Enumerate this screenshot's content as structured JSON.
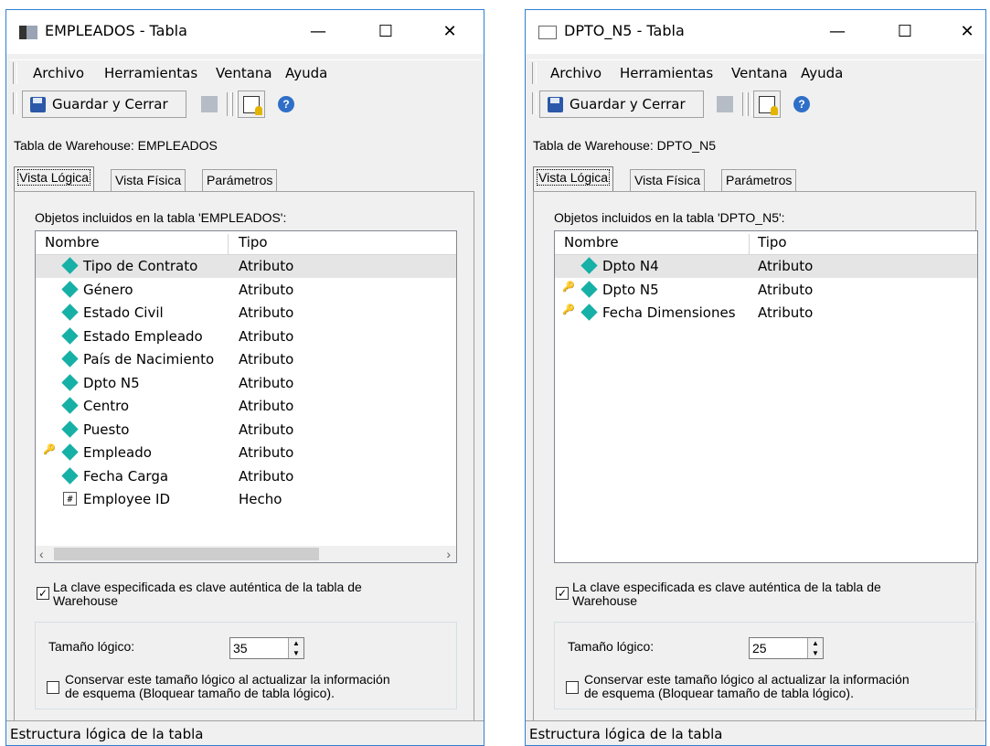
{
  "windows": [
    {
      "title": "EMPLEADOS - Tabla",
      "menu": [
        "Archivo",
        "Herramientas",
        "Ventana",
        "Ayuda"
      ],
      "toolbar": {
        "save_label": "Guardar y Cerrar"
      },
      "warehouse_label": "Tabla de Warehouse: EMPLEADOS",
      "tabs": [
        "Vista Lógica",
        "Vista Física",
        "Parámetros"
      ],
      "objects_label": "Objetos incluidos en la tabla 'EMPLEADOS':",
      "columns": [
        "Nombre",
        "Tipo"
      ],
      "rows": [
        {
          "name": "Tipo de Contrato",
          "type": "Atributo",
          "icon": "attribute-icon",
          "key": false
        },
        {
          "name": "Género",
          "type": "Atributo",
          "icon": "attribute-icon",
          "key": false
        },
        {
          "name": "Estado Civil",
          "type": "Atributo",
          "icon": "attribute-icon",
          "key": false
        },
        {
          "name": "Estado Empleado",
          "type": "Atributo",
          "icon": "attribute-icon",
          "key": false
        },
        {
          "name": "País de Nacimiento",
          "type": "Atributo",
          "icon": "attribute-icon",
          "key": false
        },
        {
          "name": "Dpto N5",
          "type": "Atributo",
          "icon": "attribute-icon",
          "key": false
        },
        {
          "name": "Centro",
          "type": "Atributo",
          "icon": "attribute-icon",
          "key": false
        },
        {
          "name": "Puesto",
          "type": "Atributo",
          "icon": "attribute-icon",
          "key": false
        },
        {
          "name": "Empleado",
          "type": "Atributo",
          "icon": "attribute-icon",
          "key": true
        },
        {
          "name": "Fecha Carga",
          "type": "Atributo",
          "icon": "attribute-icon",
          "key": false
        },
        {
          "name": "Employee ID",
          "type": "Hecho",
          "icon": "fact-icon",
          "key": false
        }
      ],
      "key_checkbox": {
        "label1": "La clave especificada es clave auténtica de la tabla de",
        "label2": "Warehouse",
        "checked": true
      },
      "logical_size_label": "Tamaño lógico:",
      "logical_size_value": "35",
      "preserve_checkbox": {
        "label1": "Conservar este tamaño lógico al actualizar la información",
        "label2": "de esquema (Bloquear tamaño de tabla lógico).",
        "checked": false
      },
      "status": "Estructura lógica de la tabla"
    },
    {
      "title": "DPTO_N5 - Tabla",
      "menu": [
        "Archivo",
        "Herramientas",
        "Ventana",
        "Ayuda"
      ],
      "toolbar": {
        "save_label": "Guardar y Cerrar"
      },
      "warehouse_label": "Tabla de Warehouse: DPTO_N5",
      "tabs": [
        "Vista Lógica",
        "Vista Física",
        "Parámetros"
      ],
      "objects_label": "Objetos incluidos en la tabla 'DPTO_N5':",
      "columns": [
        "Nombre",
        "Tipo"
      ],
      "rows": [
        {
          "name": "Dpto N4",
          "type": "Atributo",
          "icon": "attribute-icon",
          "key": false
        },
        {
          "name": "Dpto N5",
          "type": "Atributo",
          "icon": "attribute-icon",
          "key": true
        },
        {
          "name": "Fecha Dimensiones",
          "type": "Atributo",
          "icon": "attribute-icon",
          "key": true
        }
      ],
      "key_checkbox": {
        "label1": "La clave especificada es clave auténtica de la tabla de",
        "label2": "Warehouse",
        "checked": true
      },
      "logical_size_label": "Tamaño lógico:",
      "logical_size_value": "25",
      "preserve_checkbox": {
        "label1": "Conservar este tamaño lógico al actualizar la información",
        "label2": "de esquema (Bloquear tamaño de tabla lógico).",
        "checked": false
      },
      "status": "Estructura lógica de la tabla"
    }
  ],
  "glyphs": {
    "minimize": "—",
    "maximize": "☐",
    "close": "✕",
    "check": "✓",
    "key": "🔑",
    "help": "?",
    "left": "‹",
    "right": "›",
    "fact": "#"
  }
}
